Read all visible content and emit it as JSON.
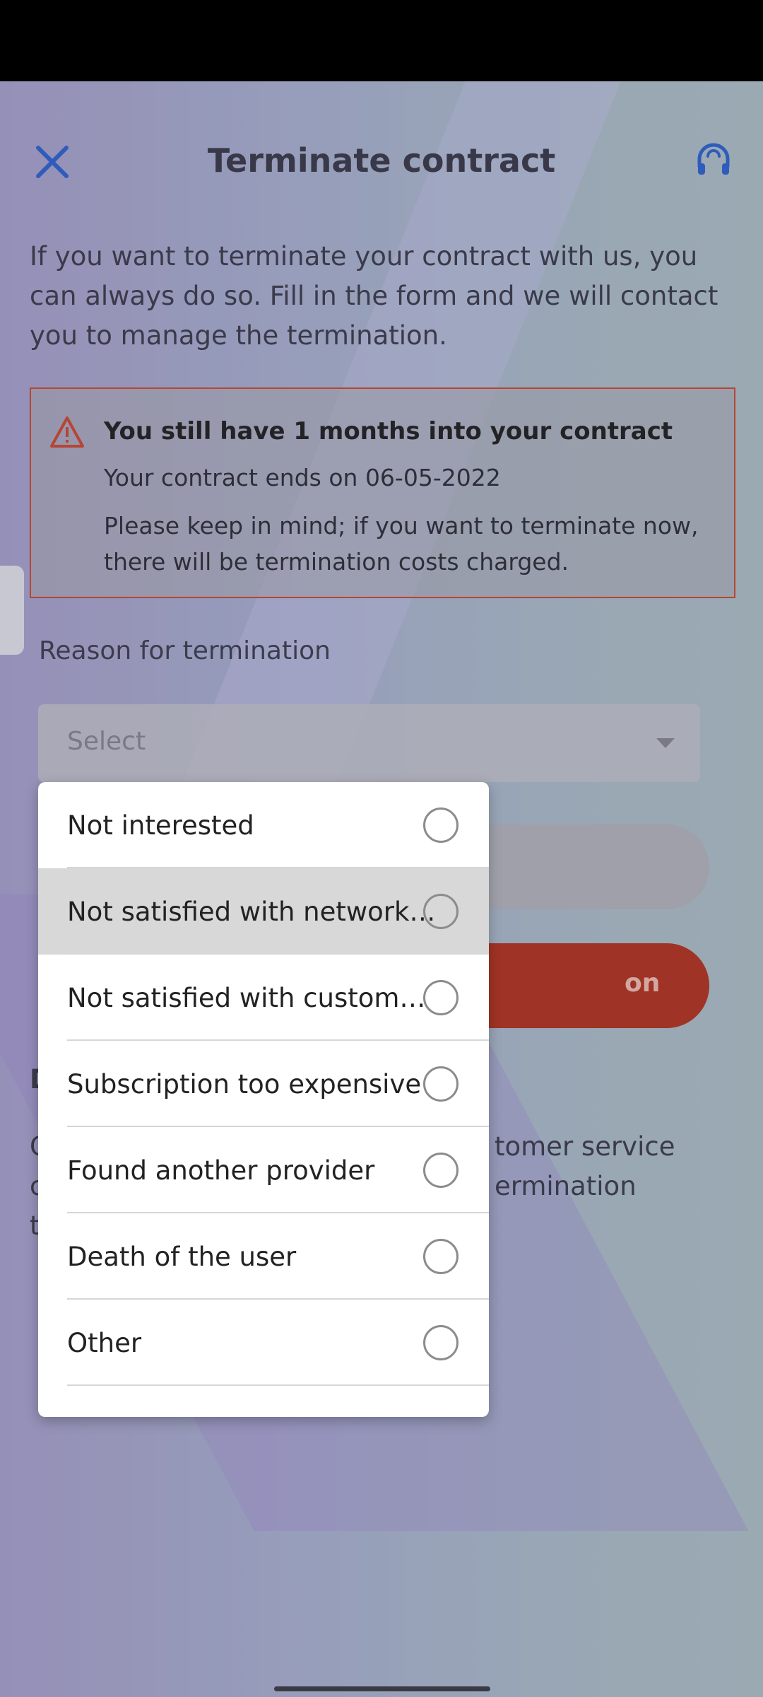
{
  "header": {
    "title": "Terminate contract",
    "close_icon": "close-icon",
    "support_icon": "headset-icon"
  },
  "intro": "If you want to terminate your contract with us, you can always do so. Fill in the form and we will contact you to manage the termination.",
  "warning": {
    "line1_prefix": "You still have ",
    "line1_value": "1 months into your contract",
    "line2_prefix": "Your contract ends on ",
    "line2_value": "06-05-2022",
    "line3": "Please keep in mind; if you want to terminate now, there will be termination costs charged.",
    "icon": "warning-triangle-icon",
    "border_color": "#c43a22"
  },
  "form": {
    "reason_label": "Reason for termination",
    "select_placeholder": "Select",
    "submit_partial": "on"
  },
  "behind": {
    "heading_fragment": "D",
    "text_line1_left": "C",
    "text_line1_right": "tomer service",
    "text_line2_left": "c",
    "text_line2_right": "ermination",
    "text_line3_left": "t"
  },
  "dropdown": {
    "options": [
      {
        "label": "Not interested",
        "selected": false
      },
      {
        "label": "Not satisfied with network…",
        "selected": true
      },
      {
        "label": "Not satisfied with custom…",
        "selected": false
      },
      {
        "label": "Subscription too expensive",
        "selected": false
      },
      {
        "label": "Found another provider",
        "selected": false
      },
      {
        "label": "Death of the user",
        "selected": false
      },
      {
        "label": "Other",
        "selected": false
      }
    ]
  },
  "colors": {
    "accent": "#1f56c6",
    "danger": "#a8240f"
  }
}
